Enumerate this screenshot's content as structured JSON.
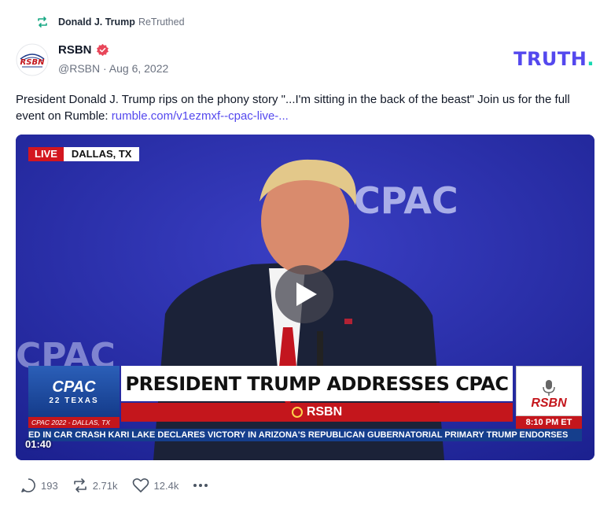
{
  "retruth": {
    "name": "Donald J. Trump",
    "verb": "ReTruthed",
    "icon": "retruth-icon"
  },
  "author": {
    "display_name": "RSBN",
    "handle_line": "@RSBN · Aug 6, 2022",
    "avatar_label": "RSBN",
    "verified_icon": "verified-badge-icon"
  },
  "brand": {
    "text": "TRUTH",
    "dot": ".",
    "color": "#5448ee",
    "dot_color": "#17d9b2"
  },
  "post": {
    "text": "President Donald J. Trump rips on the phony story \"...I'm sitting in the back of the beast\" Join us for the full event on Rumble: ",
    "link": "rumble.com/v1ezmxf--cpac-live-..."
  },
  "video": {
    "live_label": "LIVE",
    "location": "DALLAS, TX",
    "backdrop_text": "CPAC",
    "cpac_logo": "CPAC",
    "cpac_logo_sub": "22 TEXAS",
    "cpac_caption": "CPAC 2022 - DALLAS, TX",
    "headline": "PRESIDENT TRUMP ADDRESSES CPAC",
    "subbar": "RSBN",
    "rsbn_logo": "RSBN",
    "time": "8:10 PM  ET",
    "ticker": "ED IN CAR CRASH   KARI LAKE DECLARES VICTORY IN ARIZONA'S REPUBLICAN GUBERNATORIAL PRIMARY   TRUMP ENDORSES",
    "duration": "01:40",
    "play_icon": "play-icon"
  },
  "actions": {
    "replies": "193",
    "retruths": "2.71k",
    "likes": "12.4k",
    "more_icon": "more-icon"
  },
  "colors": {
    "accent": "#5448ee",
    "muted": "#6b7280",
    "video_bg": "#2a2fa8",
    "red": "#c4161c"
  }
}
